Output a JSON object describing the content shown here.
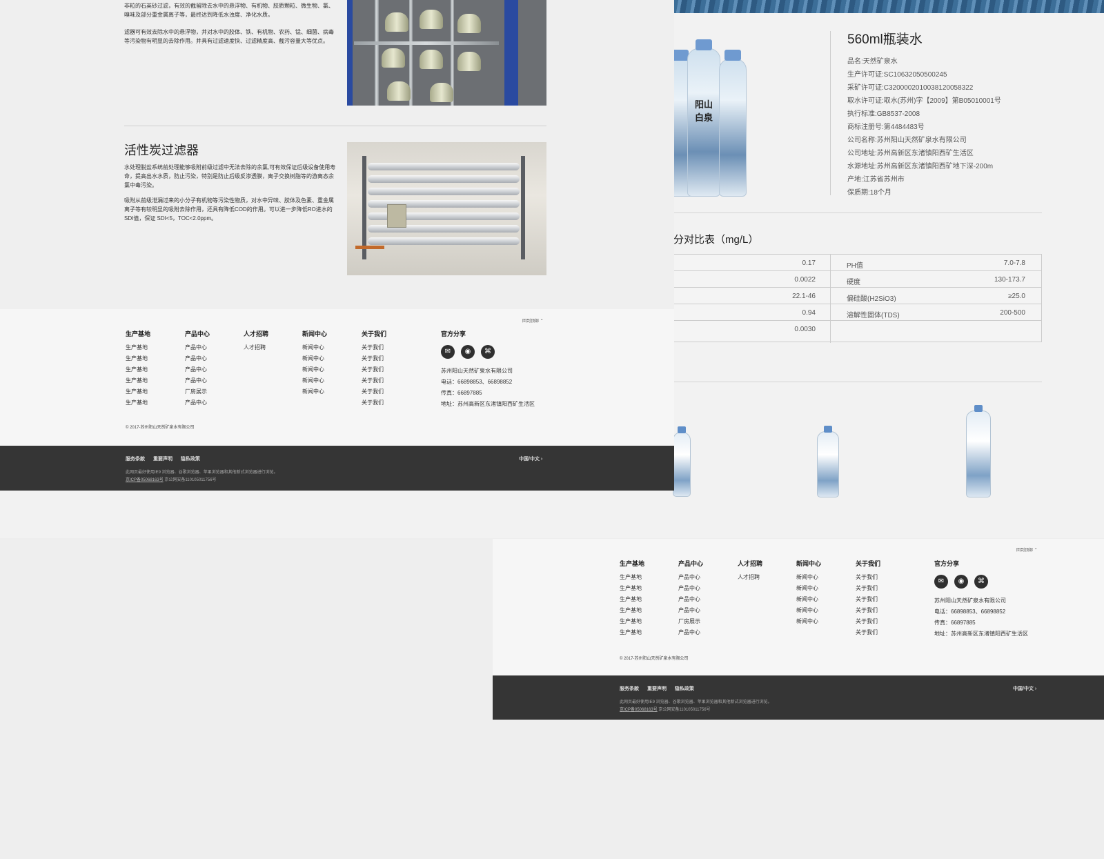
{
  "filter_page": {
    "sand_text_1": "非粒的石英砂过滤，有效的截留除去水中的悬浮物、有机物、胶质颗粒、微生物、氯、嗅味及部分重金属离子等，最终达到降低水浊度、净化水质。",
    "sand_text_2": "滤器可有效去除水中的悬浮物，并对水中的胶体、铁、有机物、农药、锰、细菌、病毒等污染物有明显的去除作用。并具有过滤速度快、过滤精度高、截污容量大等优点。",
    "carbon_heading": "活性炭过滤器",
    "carbon_text_1": "水处理脱盐系统前处理能够吸附前级过滤中无法去除的余氯,可有效保证后级设备使用寿命，提高出水水质，防止污染，特别是防止后级反渗透膜，离子交换树脂等的游离态余氯中毒污染。",
    "carbon_text_2": "吸附从前级泄漏过来的小分子有机物等污染性物质，对水中异味、胶体及色素、重金属离子等有较明显的吸附去除作用，还具有降低COD的作用。可以进一步降低RO进水的SDI值，保证 SDI<5，TOC<2.0ppm。"
  },
  "product_page": {
    "bottle_label": "阳山白泉",
    "spec_title": "560ml瓶装水",
    "specs": [
      "品名:天然矿泉水",
      "生产许可证:SC10632050500245",
      "采矿许可证:C3200002010038120058322",
      "取水许可证:取水(苏州)字【2009】第B05010001号",
      "执行标准:GB8537-2008",
      "商标注册号:第4484483号",
      "公司名称:苏州阳山天然矿泉水有限公司",
      "公司地址:苏州高新区东渚镇阳西矿生活区",
      "水源地址:苏州高新区东渚镇阳西矿地下深-200m",
      "产地:江苏省苏州市",
      "保质期:18个月"
    ],
    "table_title": "分对比表（mg/L）",
    "table_rows": [
      {
        "left_value": "0.17",
        "right_label": "PH值",
        "right_value": "7.0-7.8"
      },
      {
        "left_value": "0.0022",
        "right_label": "硬度",
        "right_value": "130-173.7"
      },
      {
        "left_value": "22.1-46",
        "right_label": "偏硅酸(H2SiO3)",
        "right_value": "≥25.0"
      },
      {
        "left_value": "0.94",
        "right_label": "溶解性固体(TDS)",
        "right_value": "200-500"
      },
      {
        "left_value": "0.0030",
        "right_label": "",
        "right_value": ""
      }
    ]
  },
  "footer": {
    "back_to_top": "回到顶部 ⌃",
    "columns": [
      {
        "heading": "生产基地",
        "items": [
          "生产基地",
          "生产基地",
          "生产基地",
          "生产基地",
          "生产基地",
          "生产基地"
        ]
      },
      {
        "heading": "产品中心",
        "items": [
          "产品中心",
          "产品中心",
          "产品中心",
          "产品中心",
          "厂房展示",
          "产品中心"
        ]
      },
      {
        "heading": "人才招聘",
        "items": [
          "人才招聘"
        ]
      },
      {
        "heading": "新闻中心",
        "items": [
          "新闻中心",
          "新闻中心",
          "新闻中心",
          "新闻中心",
          "新闻中心"
        ]
      },
      {
        "heading": "关于我们",
        "items": [
          "关于我们",
          "关于我们",
          "关于我们",
          "关于我们",
          "关于我们",
          "关于我们"
        ]
      }
    ],
    "share_heading": "官方分享",
    "social_icons": [
      {
        "name": "wechat-icon",
        "glyph": "✉"
      },
      {
        "name": "weibo-icon",
        "glyph": "◉"
      },
      {
        "name": "qrcode-icon",
        "glyph": "⌘"
      }
    ],
    "company": "苏州阳山天然矿泉水有限公司",
    "phone": "电话：66898853、66898852",
    "fax": "传真：66897885",
    "address": "地址：苏州高新区东渚镇阳西矿生活区",
    "copyright": "© 2017-苏州阳山天然矿泉水有限公司",
    "legal_links": [
      "服务条款",
      "重要声明",
      "隐私政策"
    ],
    "locale": "中国/中文 ›",
    "browser_note": "此网页最好使用IE9 浏览器、谷歌浏览器、苹果浏览器和其他新式浏览器进行浏览。",
    "icp": "京ICP备05068163号",
    "police": "京公网安备110105011756号"
  },
  "colors": {
    "dark_footer": "#353535",
    "light_footer": "#f6f6f6",
    "page_bg": "#eeeeee",
    "wave_blue": "#3c6e98"
  }
}
